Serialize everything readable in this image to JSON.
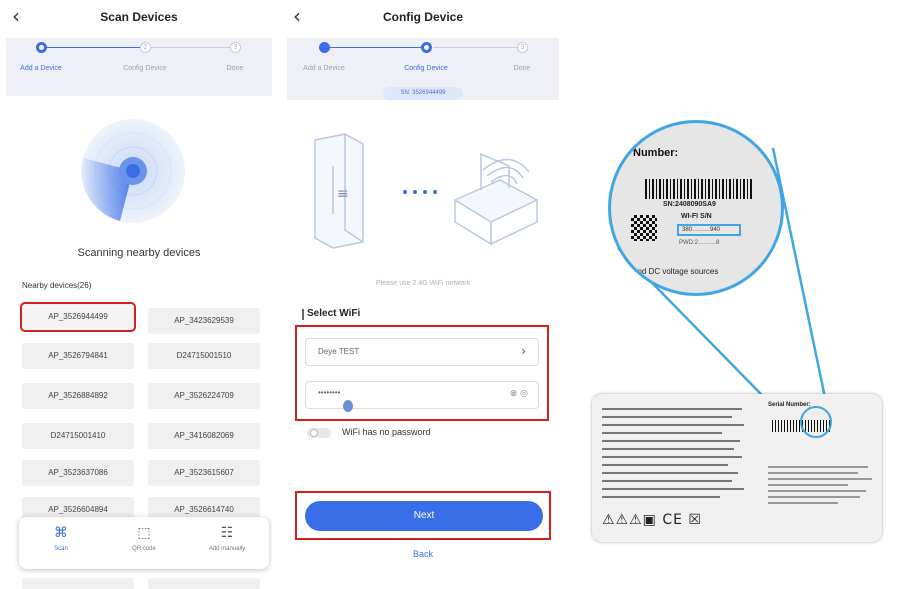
{
  "screen1": {
    "title": "Scan Devices",
    "steps": [
      {
        "label": "Add a Device",
        "state": "active"
      },
      {
        "label": "Config Device",
        "state": "idle",
        "num": "2"
      },
      {
        "label": "Done",
        "state": "idle",
        "num": "3"
      }
    ],
    "scanning_text": "Scanning nearby devices",
    "nearby_label": "Nearby devices(26)",
    "devices": [
      "AP_3526944499",
      "AP_3423629539",
      "AP_3526794841",
      "D24715001510",
      "AP_3526884892",
      "AP_3526224709",
      "D24715001410",
      "AP_3416082069",
      "AP_3523637086",
      "AP_3523615607",
      "AP_3526604894",
      "AP_3526614740"
    ],
    "bottom_bar": [
      {
        "label": "Scan",
        "icon": "scan-icon"
      },
      {
        "label": "QR code",
        "icon": "qr-code-icon"
      },
      {
        "label": "Add manually",
        "icon": "grid-icon"
      }
    ],
    "accent": "#3a6ee8"
  },
  "screen2": {
    "title": "Config Device",
    "steps": [
      {
        "label": "Add a Device",
        "state": "done"
      },
      {
        "label": "Config Device",
        "state": "active"
      },
      {
        "label": "Done",
        "state": "idle",
        "num": "3"
      }
    ],
    "sn": "SN: 3526944499",
    "hint": "Please use 2.4G WiFi network",
    "select_wifi": "Select WiFi",
    "wifi_name": "Deye TEST",
    "password_mask": "••••••••",
    "no_password_label": "WiFi has no password",
    "next_label": "Next",
    "back_label": "Back"
  },
  "label_zoom": {
    "heading": "Number:",
    "sn": "SN:2408090SA9",
    "wifi_sn": "WI-FI S/N",
    "wifi_sn_value": "380………940",
    "pwd": "PWD:2………8",
    "footer": "C and DC voltage sources",
    "serial_heading": "Serial Number:",
    "highlight": "#3fa6e3"
  }
}
